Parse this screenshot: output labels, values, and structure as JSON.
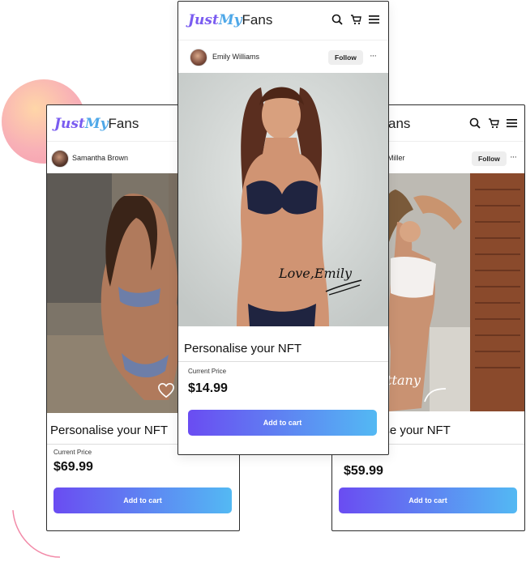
{
  "brand": {
    "part1": "Just",
    "part2": "My",
    "part3": "Fans"
  },
  "icons": [
    "search-icon",
    "cart-icon",
    "menu-icon",
    "more-icon",
    "heart-icon"
  ],
  "colors": {
    "gradient_start": "#6a4cf2",
    "gradient_end": "#53b9f3",
    "brand_just": "#7a5cf0",
    "brand_my": "#4fa8e8"
  },
  "cards": {
    "left": {
      "user": "Samantha Brown",
      "title": "Personalise your NFT",
      "price_label": "Current Price",
      "price": "$69.99",
      "button": "Add to cart"
    },
    "center": {
      "user": "Emily Williams",
      "follow": "Follow",
      "more": "···",
      "signature": "Love,Emily",
      "title": "Personalise your NFT",
      "price_label": "Current Price",
      "price": "$14.99",
      "button": "Add to cart"
    },
    "right": {
      "brand_visible": "ans",
      "user_visible": "Miller",
      "follow": "Follow",
      "more": "···",
      "signature_visible": "ittany",
      "title_visible": "ise your NFT",
      "price": "$59.99",
      "button": "Add to cart"
    }
  }
}
